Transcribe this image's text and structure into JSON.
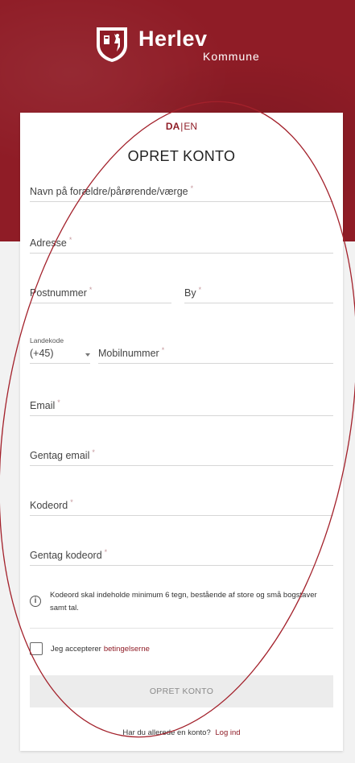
{
  "header": {
    "brand_name": "Herlev",
    "brand_sub": "Kommune",
    "background_color": "#8f1c26"
  },
  "language": {
    "active": "DA",
    "separator": "|",
    "other": "EN"
  },
  "form": {
    "title": "OPRET KONTO",
    "required_marker": "*",
    "fields": {
      "guardian_name": "Navn på forældre/pårørende/værge",
      "address": "Adresse",
      "postal_code": "Postnummer",
      "city": "By",
      "country_code_label": "Landekode",
      "country_code_value": "(+45)",
      "mobile": "Mobilnummer",
      "email": "Email",
      "repeat_email": "Gentag email",
      "password": "Kodeord",
      "repeat_password": "Gentag kodeord"
    },
    "password_hint": "Kodeord skal indeholde minimum 6 tegn, bestående af store og små bogstaver samt tal.",
    "terms_prefix": "Jeg accepterer",
    "terms_link": "betingelserne",
    "submit_label": "OPRET KONTO",
    "login_prompt": "Har du allerede en konto?",
    "login_link": "Log ind",
    "accent_color": "#8f1c26"
  },
  "icons": {
    "logo": "herlev-shield-icon",
    "info": "info-circle-icon",
    "select_caret": "caret-down-icon"
  }
}
